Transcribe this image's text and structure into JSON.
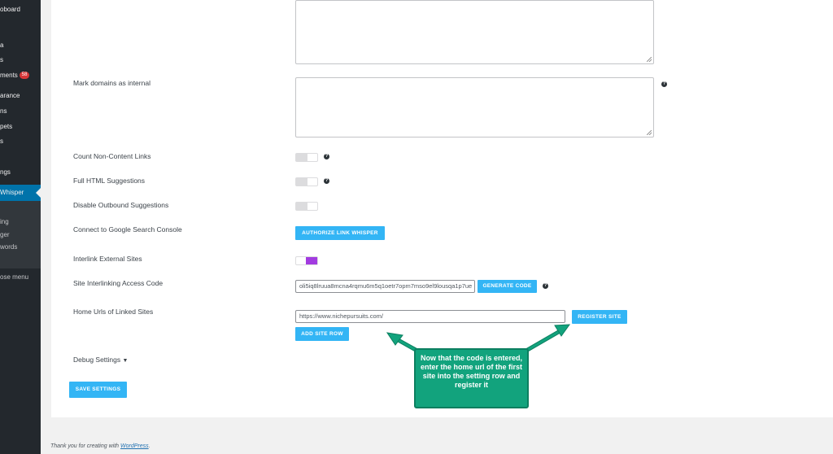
{
  "sidebar": {
    "items": [
      {
        "label": "oboard"
      },
      {
        "label": "a"
      },
      {
        "label": "s"
      },
      {
        "label": "ments",
        "badge": "58"
      },
      {
        "label": "arance"
      },
      {
        "label": "ns"
      },
      {
        "label": "pets"
      },
      {
        "label": "s"
      },
      {
        "label": "ngs"
      },
      {
        "label": "Whisper"
      },
      {
        "label": "ing"
      },
      {
        "label": "ger"
      },
      {
        "label": "words"
      },
      {
        "label": "ose menu"
      }
    ]
  },
  "settings": {
    "mark_domains_label": "Mark domains as internal",
    "count_non_content_label": "Count Non-Content Links",
    "full_html_label": "Full HTML Suggestions",
    "disable_outbound_label": "Disable Outbound Suggestions",
    "gsc_label": "Connect to Google Search Console",
    "authorize_button": "AUTHORIZE LINK WHISPER",
    "interlink_label": "Interlink External Sites",
    "interlink_enabled": true,
    "access_code_label": "Site Interlinking Access Code",
    "access_code_value": "oli5iq8lruua8mcna4rqmu6m5q1oetr7opm7mso9el9lousqa1p7ue",
    "generate_code_button": "GENERATE CODE",
    "home_urls_label": "Home Urls of Linked Sites",
    "home_url_value": "https://www.nichepursuits.com/",
    "register_site_button": "REGISTER SITE",
    "add_site_row_button": "ADD SITE ROW",
    "debug_settings_label": "Debug Settings",
    "save_settings_button": "SAVE SETTINGS"
  },
  "annotation": {
    "text": "Now that the code is entered, enter the home url of the first site into the setting row and register it",
    "color": "#12a37d"
  },
  "footer": {
    "text": "Thank you for creating with ",
    "link": "WordPress",
    "suffix": "."
  },
  "colors": {
    "accent_button": "#33b5f5",
    "toggle_on": "#a23be0",
    "sidebar_bg": "#23282d",
    "sidebar_active": "#0073aa"
  }
}
